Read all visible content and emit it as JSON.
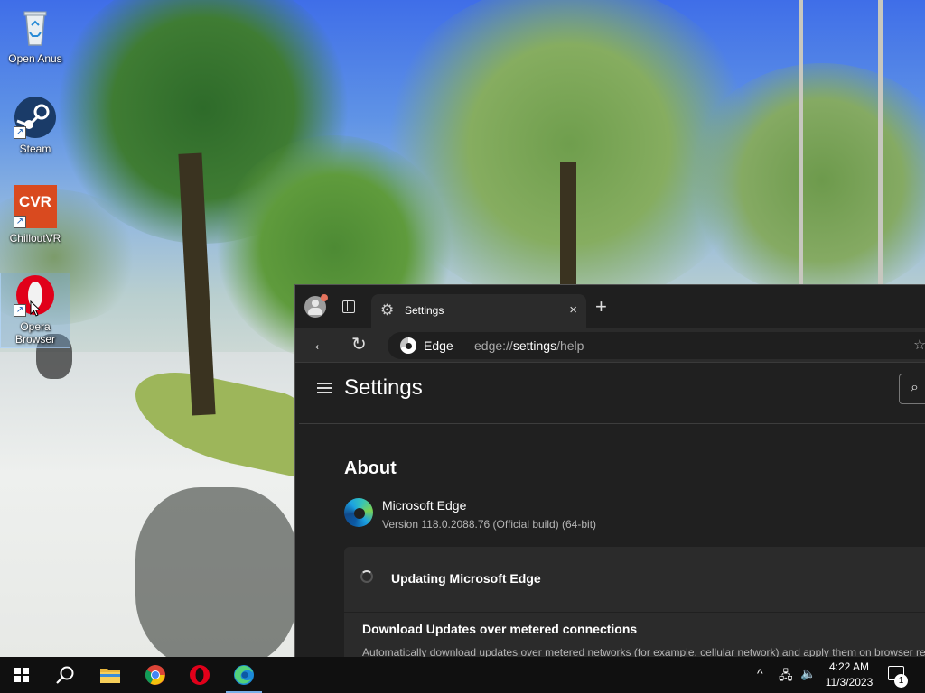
{
  "desktop": {
    "icons": [
      {
        "label": "Open Anus",
        "icon": "recycle-bin-icon"
      },
      {
        "label": "Steam",
        "icon": "steam-icon"
      },
      {
        "label": "ChilloutVR",
        "icon": "chilloutvr-icon",
        "badge": "CVR"
      },
      {
        "label": "Opera Browser",
        "icon": "opera-icon"
      }
    ]
  },
  "browser": {
    "tab": {
      "title": "Settings",
      "close": "×",
      "gear": "⚙"
    },
    "new_tab": "+",
    "toolbar": {
      "back": "←",
      "refresh": "↻"
    },
    "address": {
      "site": "Edge",
      "url_prefix": "edge://",
      "url_host": "settings",
      "url_path": "/help",
      "favorite": "☆"
    },
    "settings": {
      "title": "Settings",
      "search_icon": "⌕",
      "section_title": "About",
      "product_name": "Microsoft Edge",
      "version": "Version 118.0.2088.76 (Official build) (64-bit)",
      "update_status": "Updating Microsoft Edge",
      "metered_title": "Download Updates over metered connections",
      "metered_desc": "Automatically download updates over metered networks (for example, cellular network) and apply them on browser re"
    }
  },
  "taskbar": {
    "pinned": [
      "start-button",
      "search-button",
      "file-explorer",
      "chrome",
      "opera",
      "edge"
    ],
    "tray": {
      "chevron": "^",
      "network": "🖧",
      "volume": "🔈",
      "time": "4:22 AM",
      "date": "11/3/2023",
      "notification_count": "1"
    }
  },
  "colors": {
    "taskbar": "#101010",
    "edge_dark": "#202020",
    "tab_active": "#2b2b2b",
    "opera_red": "#e1001a",
    "cvr_orange": "#d94a1f"
  }
}
